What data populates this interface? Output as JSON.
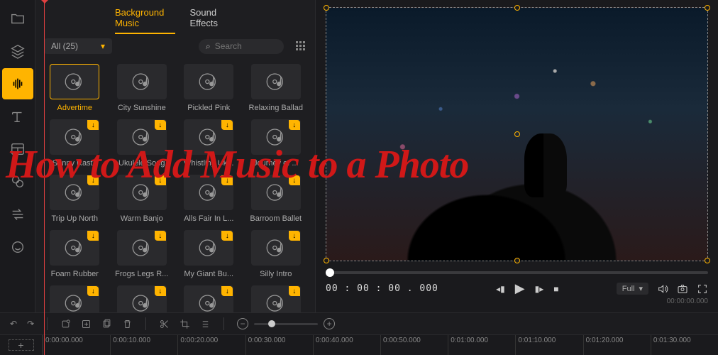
{
  "overlay": "How to Add Music to a Photo",
  "tabs": {
    "bg_music": "Background Music",
    "sfx": "Sound Effects"
  },
  "filter": {
    "label": "All (25)"
  },
  "search": {
    "placeholder": "Search"
  },
  "music": [
    {
      "label": "Advertime",
      "dl": false,
      "selected": true
    },
    {
      "label": "City Sunshine",
      "dl": false
    },
    {
      "label": "Pickled Pink",
      "dl": false
    },
    {
      "label": "Relaxing Ballad",
      "dl": false
    },
    {
      "label": "Sunny Rasta",
      "dl": true
    },
    {
      "label": "Ukulele Song",
      "dl": true
    },
    {
      "label": "Whistling Uk...",
      "dl": true
    },
    {
      "label": "Journey of ...",
      "dl": true
    },
    {
      "label": "Trip Up North",
      "dl": true
    },
    {
      "label": "Warm Banjo",
      "dl": true
    },
    {
      "label": "Alls Fair In L...",
      "dl": true
    },
    {
      "label": "Barroom Ballet",
      "dl": true
    },
    {
      "label": "Foam Rubber",
      "dl": true
    },
    {
      "label": "Frogs Legs R...",
      "dl": true
    },
    {
      "label": "My Giant Bu...",
      "dl": true
    },
    {
      "label": "Silly Intro",
      "dl": true
    }
  ],
  "player": {
    "timecode": "00 : 00 : 00 . 000",
    "duration": "00:00:00.000",
    "full": "Full"
  },
  "timeline": {
    "ticks": [
      "0:00:00.000",
      "0:00:10.000",
      "0:00:20.000",
      "0:00:30.000",
      "0:00:40.000",
      "0:00:50.000",
      "0:01:00.000",
      "0:01:10.000",
      "0:01:20.000",
      "0:01:30.000"
    ]
  }
}
